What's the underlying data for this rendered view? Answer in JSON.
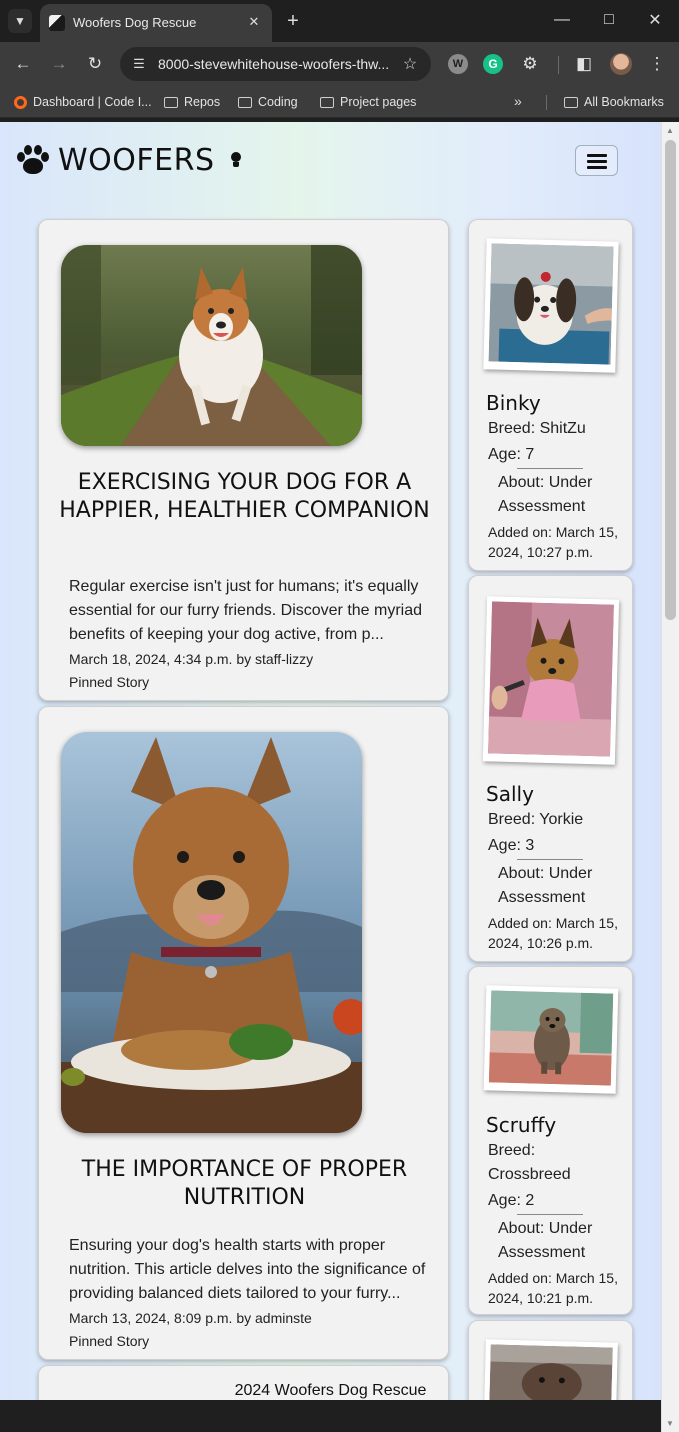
{
  "browser": {
    "tab_title": "Woofers Dog Rescue",
    "url": "8000-stevewhitehouse-woofers-thw...",
    "bookmarks": [
      "Dashboard | Code I...",
      "Repos",
      "Coding",
      "Project pages"
    ],
    "all_bookmarks": "All Bookmarks",
    "ext_w": "W",
    "ext_g": "G"
  },
  "site": {
    "brand": "WOOFERS",
    "footer": "2024 Woofers Dog Rescue",
    "social": [
      "facebook-icon",
      "twitter-icon",
      "instagram-icon",
      "youtube-icon"
    ]
  },
  "posts": [
    {
      "title": "EXERCISING YOUR DOG FOR A HAPPIER, HEALTHIER COMPANION",
      "excerpt": "Regular exercise isn't just for humans; it's equally essential for our furry friends. Discover the myriad benefits of keeping your dog active, from p...",
      "meta": "March 18, 2024, 4:34 p.m. by staff-lizzy",
      "pinned": "Pinned Story"
    },
    {
      "title": "THE IMPORTANCE OF PROPER NUTRITION",
      "excerpt": "Ensuring your dog's health starts with proper nutrition. This article delves into the significance of providing balanced diets tailored to your furry...",
      "meta": "March 13, 2024, 8:09 p.m. by adminste",
      "pinned": "Pinned Story"
    }
  ],
  "dogs": [
    {
      "name": "Binky",
      "breed": "Breed: ShitZu",
      "age": "Age: 7",
      "about": "About: Under Assessment",
      "added": "Added on: March 15, 2024, 10:27 p.m."
    },
    {
      "name": "Sally",
      "breed": "Breed: Yorkie",
      "age": "Age: 3",
      "about": "About: Under Assessment",
      "added": "Added on: March 15, 2024, 10:26 p.m."
    },
    {
      "name": "Scruffy",
      "breed": "Breed: Crossbreed",
      "age": "Age: 2",
      "about": "About: Under Assessment",
      "added": "Added on: March 15, 2024, 10:21 p.m."
    }
  ]
}
